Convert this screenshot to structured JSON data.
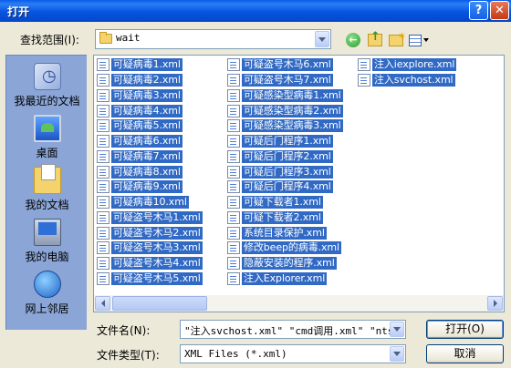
{
  "window": {
    "title": "打开",
    "help_glyph": "?",
    "close_glyph": "✕"
  },
  "lookin": {
    "label": "查找范围(I):",
    "value": "wait"
  },
  "places": [
    {
      "label": "我最近的文档",
      "icon": "recent-documents-icon"
    },
    {
      "label": "桌面",
      "icon": "desktop-icon"
    },
    {
      "label": "我的文档",
      "icon": "my-documents-icon"
    },
    {
      "label": "我的电脑",
      "icon": "my-computer-icon"
    },
    {
      "label": "网上邻居",
      "icon": "network-places-icon"
    }
  ],
  "files": {
    "col1": [
      "可疑病毒1.xml",
      "可疑病毒2.xml",
      "可疑病毒3.xml",
      "可疑病毒4.xml",
      "可疑病毒5.xml",
      "可疑病毒6.xml",
      "可疑病毒7.xml",
      "可疑病毒8.xml",
      "可疑病毒9.xml",
      "可疑病毒10.xml",
      "可疑盗号木马1.xml",
      "可疑盗号木马2.xml",
      "可疑盗号木马3.xml",
      "可疑盗号木马4.xml",
      "可疑盗号木马5.xml"
    ],
    "col2": [
      "可疑盗号木马6.xml",
      "可疑盗号木马7.xml",
      "可疑感染型病毒1.xml",
      "可疑感染型病毒2.xml",
      "可疑感染型病毒3.xml",
      "可疑后门程序1.xml",
      "可疑后门程序2.xml",
      "可疑后门程序3.xml",
      "可疑后门程序4.xml",
      "可疑下载者1.xml",
      "可疑下载者2.xml",
      "系统目录保护.xml",
      "修改beep的病毒.xml",
      "隐蔽安装的程序.xml",
      "注入Explorer.xml"
    ],
    "col3": [
      "注入iexplore.xml",
      "注入svchost.xml"
    ]
  },
  "filename": {
    "label": "文件名(N):",
    "value": "\"注入svchost.xml\" \"cmd调用.xml\" \"ntsd"
  },
  "filetype": {
    "label": "文件类型(T):",
    "value": "XML Files (*.xml)"
  },
  "buttons": {
    "open": "打开(O)",
    "cancel": "取消"
  }
}
